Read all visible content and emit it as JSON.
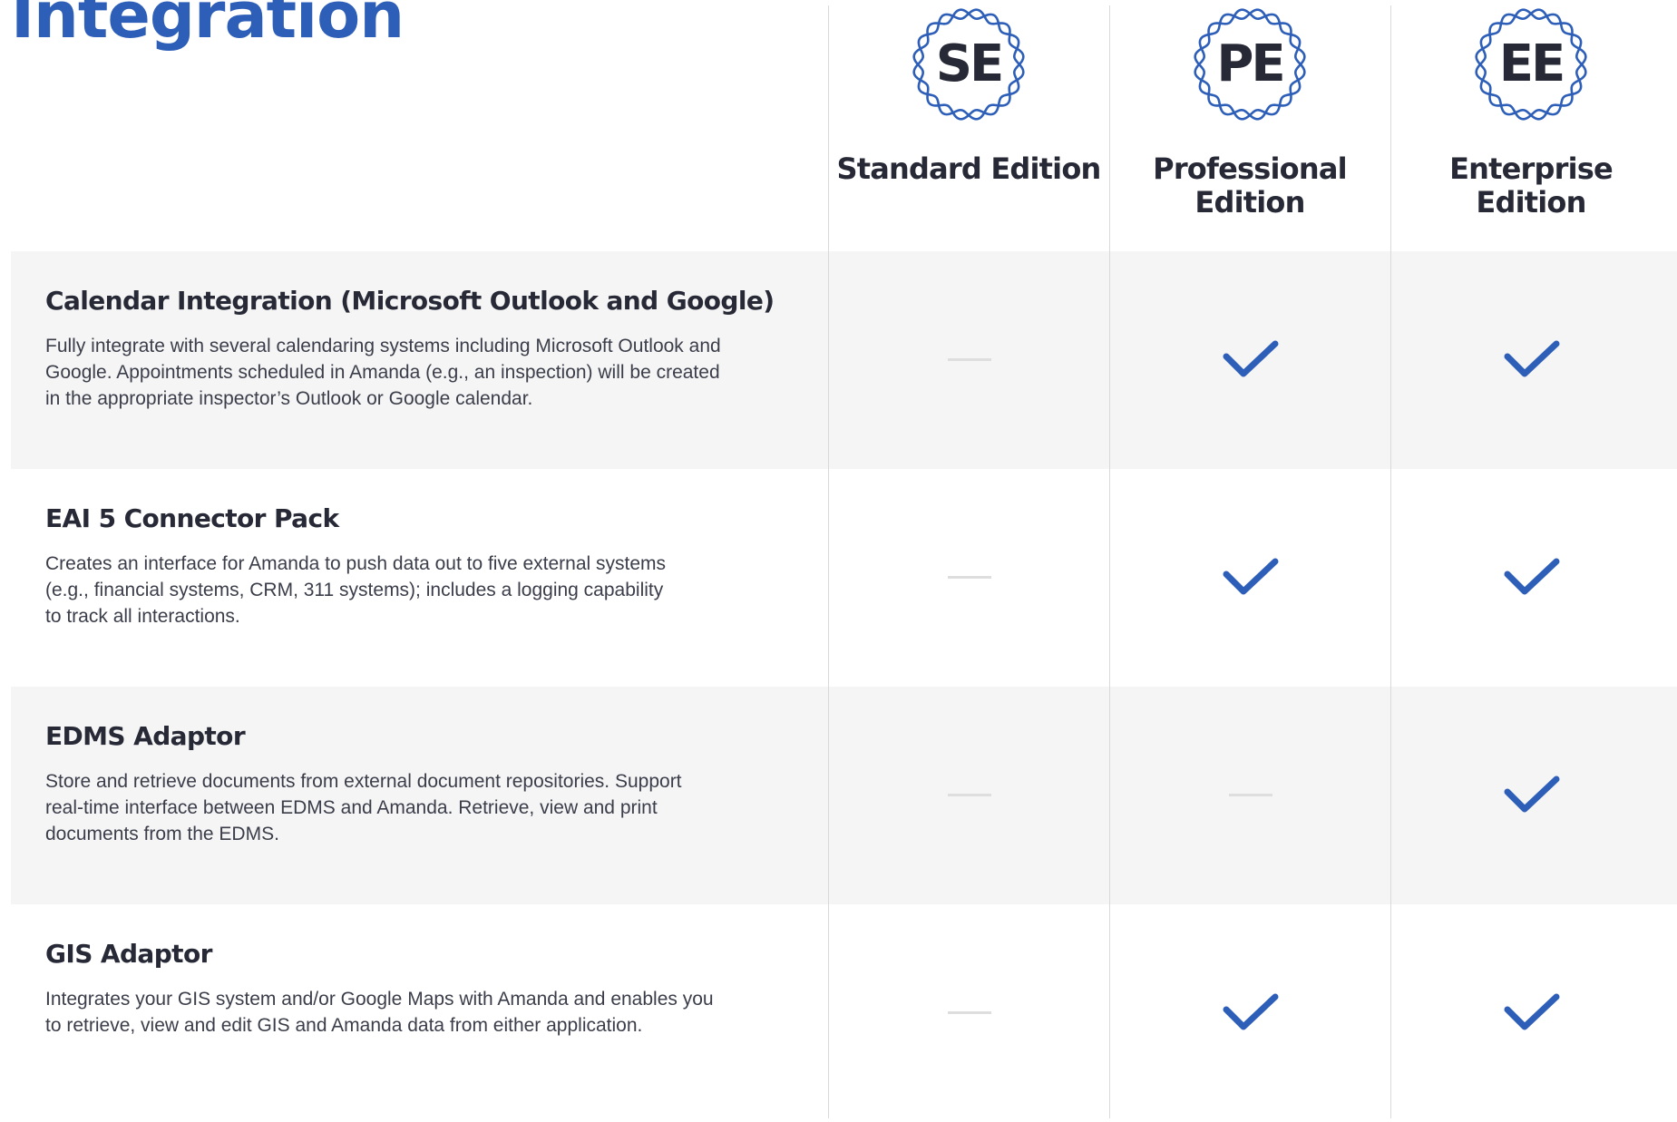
{
  "page": {
    "title": "Integration"
  },
  "colors": {
    "brand_blue": "#2e5fb8",
    "dark_text": "#272a36",
    "row_band": "#f5f5f5",
    "divider": "#d9d9d9",
    "dash": "#dedede"
  },
  "editions": [
    {
      "code": "SE",
      "name": "Standard Edition"
    },
    {
      "code": "PE",
      "name": "Professional Edition"
    },
    {
      "code": "EE",
      "name": "Enterprise Edition"
    }
  ],
  "features": [
    {
      "title": "Calendar Integration (Microsoft Outlook and Google)",
      "description": "Fully integrate with several calendaring systems including Microsoft Outlook and\nGoogle. Appointments scheduled in Amanda (e.g., an inspection) will be created\nin the appropriate inspector’s Outlook or Google calendar.",
      "availability": [
        "dash",
        "check",
        "check"
      ]
    },
    {
      "title": "EAI 5 Connector Pack",
      "description": "Creates an interface for Amanda to push data out to five external systems\n(e.g., financial systems, CRM, 311 systems); includes a logging capability\nto track all interactions.",
      "availability": [
        "dash",
        "check",
        "check"
      ]
    },
    {
      "title": "EDMS Adaptor",
      "description": "Store  and retrieve documents from external document repositories. Support\nreal-time interface between EDMS and  Amanda.  Retrieve, view  and print\ndocuments  from the EDMS.",
      "availability": [
        "dash",
        "dash",
        "check"
      ]
    },
    {
      "title": "GIS Adaptor",
      "description": " Integrates your GIS system and/or Google Maps with Amanda and enables you\nto retrieve, view and edit GIS and Amanda data from either application.",
      "availability": [
        "dash",
        "check",
        "check"
      ]
    }
  ],
  "icons": {
    "included": "check-icon",
    "not_included": "dash-icon",
    "badge": "wavy-seal-icon"
  }
}
